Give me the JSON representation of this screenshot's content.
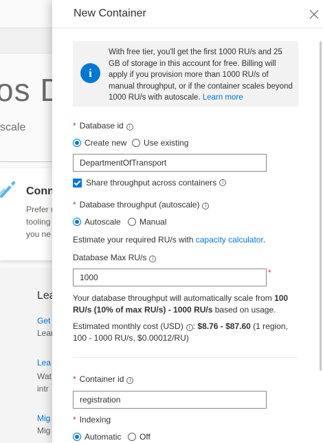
{
  "background": {
    "hero_title": "os D",
    "hero_subtitle": "scale",
    "card_title": "Conn",
    "card_lines": [
      "Prefer u",
      "tooling",
      "you ne"
    ],
    "learn_heading": "Lea",
    "link_1": "Get",
    "text_1": "Lear",
    "link_2": "Lea",
    "text_2a": "Wat",
    "text_2b": "intr",
    "link_3": "Mig",
    "text_3": "Mig"
  },
  "panel": {
    "title": "New Container",
    "close_label": "×",
    "info": {
      "text": "With free tier, you'll get the first 1000 RU/s and 25 GB of storage in this account for free. Billing will apply if you provision more than 1000 RU/s of manual throughput, or if the container scales beyond 1000 RU/s with autoscale.",
      "link": "Learn more"
    },
    "database_id": {
      "required": "*",
      "label": "Database id",
      "help": "i",
      "options": [
        "Create new",
        "Use existing"
      ],
      "selected": "Create new",
      "value": "DepartmentOfTransport"
    },
    "share_throughput": {
      "label": "Share throughput across containers",
      "help": "i",
      "checked": true
    },
    "db_throughput": {
      "required": "*",
      "label": "Database throughput (autoscale)",
      "help": "i",
      "options": [
        "Autoscale",
        "Manual"
      ],
      "selected": "Autoscale",
      "estimate_text": "Estimate your required RU/s with",
      "estimate_link": "capacity calculator",
      "estimate_end": "."
    },
    "max_rus": {
      "label": "Database Max RU/s",
      "help": "i",
      "value": "1000",
      "required": "*"
    },
    "scale_note": {
      "part1": "Your database throughput will automatically scale from",
      "bold1": "100 RU/s (10% of max RU/s) - 1000 RU/s",
      "part2": "based on usage."
    },
    "cost": {
      "label": "Estimated monthly cost (USD)",
      "help": "i",
      "colon": ":",
      "value": "$8.76 - $87.60",
      "detail": "(1 region, 100 - 1000 RU/s, $0.00012/RU)"
    },
    "container_id": {
      "required": "*",
      "label": "Container id",
      "help": "i",
      "value": "registration"
    },
    "indexing": {
      "required": "*",
      "label": "Indexing",
      "options": [
        "Automatic",
        "Off"
      ],
      "selected": "Automatic"
    }
  },
  "colors": {
    "accent": "#0078d4",
    "required": "#d13438",
    "info_bg": "#f2f2f2"
  }
}
